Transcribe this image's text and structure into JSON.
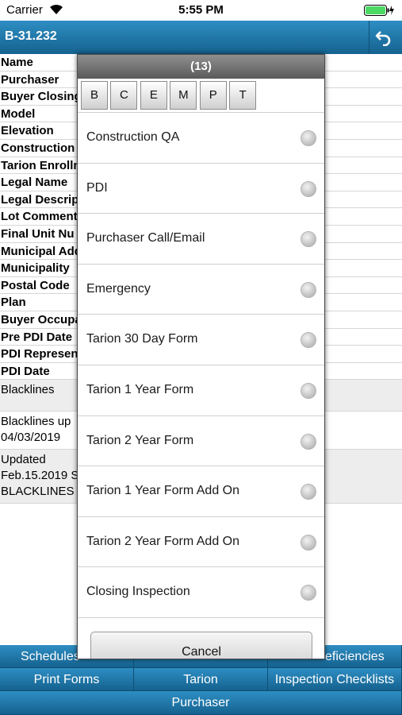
{
  "status_bar": {
    "carrier": "Carrier",
    "time": "5:55 PM"
  },
  "nav": {
    "title": "B-31.232"
  },
  "details": {
    "labels": [
      "Name",
      "Purchaser",
      "Buyer Closing",
      "Model",
      "Elevation",
      "Construction I",
      "Tarion Enrollm",
      "Legal Name",
      "Legal Descrip",
      "Lot Comment",
      "Final Unit Nu",
      "Municipal Add",
      "Municipality",
      "Postal Code",
      "Plan",
      "Buyer Occupa",
      "Pre PDI Date",
      "PDI Represen",
      "PDI Date"
    ],
    "notes": [
      {
        "line1": "Blacklines",
        "line2": "",
        "line3": ""
      },
      {
        "line1": "Blacklines up",
        "line2": "04/03/2019",
        "line3": ""
      },
      {
        "line1": "Updated",
        "line2": "Feb.15.2019 S",
        "line3": "BLACKLINES"
      }
    ]
  },
  "bottom_tabs": {
    "schedules": "Schedules",
    "deficiencies": "eficiencies",
    "print_forms": "Print Forms",
    "tarion": "Tarion",
    "inspection_checklists": "Inspection Checklists",
    "purchaser": "Purchaser"
  },
  "modal": {
    "header": "(13)",
    "filters": [
      "B",
      "C",
      "E",
      "M",
      "P",
      "T"
    ],
    "options": [
      "Construction QA",
      "PDI",
      "Purchaser Call/Email",
      "Emergency",
      "Tarion 30 Day Form",
      "Tarion 1 Year Form",
      "Tarion 2 Year Form",
      "Tarion 1 Year Form Add On",
      "Tarion 2 Year Form Add On",
      "Closing Inspection"
    ],
    "cancel_label": "Cancel"
  }
}
